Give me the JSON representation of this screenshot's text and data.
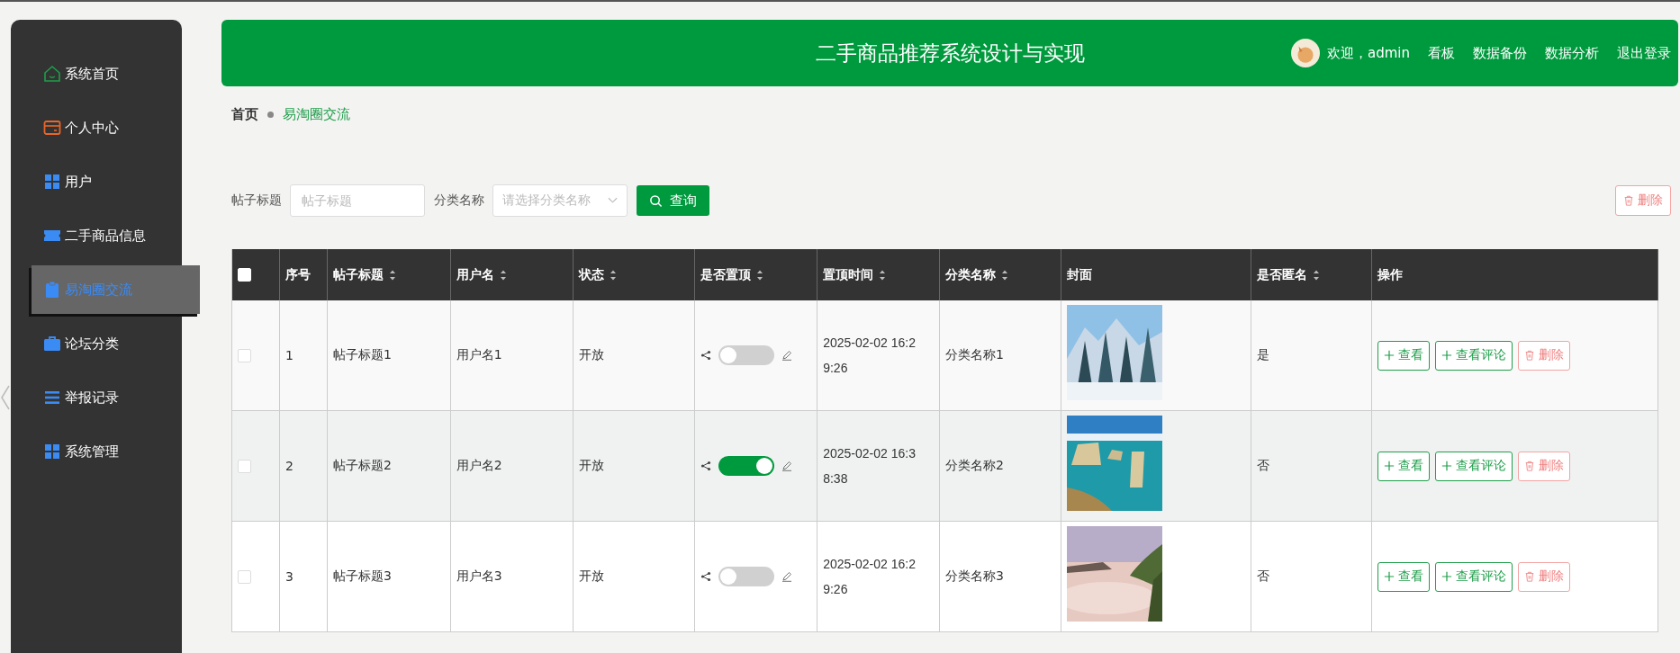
{
  "sidebar": {
    "items": [
      {
        "label": "系统首页",
        "selected": false
      },
      {
        "label": "个人中心",
        "selected": false
      },
      {
        "label": "用户",
        "selected": false
      },
      {
        "label": "二手商品信息",
        "selected": false
      },
      {
        "label": "易淘圈交流",
        "selected": true
      },
      {
        "label": "论坛分类",
        "selected": false
      },
      {
        "label": "举报记录",
        "selected": false
      },
      {
        "label": "系统管理",
        "selected": false
      }
    ]
  },
  "header": {
    "title": "二手商品推荐系统设计与实现",
    "welcome": "欢迎，admin",
    "links": [
      "看板",
      "数据备份",
      "数据分析",
      "退出登录"
    ]
  },
  "breadcrumb": [
    "首页",
    "易淘圈交流"
  ],
  "search": {
    "fields": [
      {
        "label": "帖子标题",
        "placeholder": "帖子标题",
        "kind": "input"
      },
      {
        "label": "分类名称",
        "placeholder": "请选择分类名称",
        "kind": "select"
      }
    ],
    "button": "查询",
    "delete": "删除"
  },
  "table": {
    "all_checked": false,
    "columns": [
      {
        "label": "序号",
        "sortable": false
      },
      {
        "label": "帖子标题",
        "sortable": true
      },
      {
        "label": "用户名",
        "sortable": true
      },
      {
        "label": "状态",
        "sortable": true
      },
      {
        "label": "是否置顶",
        "sortable": true
      },
      {
        "label": "置顶时间",
        "sortable": true
      },
      {
        "label": "分类名称",
        "sortable": true
      },
      {
        "label": "封面",
        "sortable": false
      },
      {
        "label": "是否匿名",
        "sortable": true
      },
      {
        "label": "操作",
        "sortable": false
      }
    ],
    "rows": [
      {
        "checked": false,
        "index": "1",
        "title": "帖子标题1",
        "user": "用户名1",
        "status": "开放",
        "pinned": false,
        "pinned_time": "2025-02-02 16:29:26",
        "category": "分类名称1",
        "cover": {
          "kind": "picture"
        },
        "anonymous": "是",
        "actions": [
          {
            "label": "查看",
            "kind": "primary"
          },
          {
            "label": "查看评论",
            "kind": "primary"
          },
          {
            "label": "删除",
            "kind": "danger"
          }
        ]
      },
      {
        "checked": false,
        "index": "2",
        "title": "帖子标题2",
        "user": "用户名2",
        "status": "开放",
        "pinned": true,
        "pinned_time": "2025-02-02 16:38:38",
        "category": "分类名称2",
        "cover": {
          "kind": "picture"
        },
        "anonymous": "否",
        "actions": [
          {
            "label": "查看",
            "kind": "primary"
          },
          {
            "label": "查看评论",
            "kind": "primary"
          },
          {
            "label": "删除",
            "kind": "danger"
          }
        ]
      },
      {
        "checked": false,
        "index": "3",
        "title": "帖子标题3",
        "user": "用户名3",
        "status": "开放",
        "pinned": false,
        "pinned_time": "2025-02-02 16:29:26",
        "category": "分类名称3",
        "cover": {
          "kind": "picture"
        },
        "anonymous": "否",
        "actions": [
          {
            "label": "查看",
            "kind": "primary"
          },
          {
            "label": "查看评论",
            "kind": "primary"
          },
          {
            "label": "删除",
            "kind": "danger"
          }
        ]
      }
    ]
  }
}
